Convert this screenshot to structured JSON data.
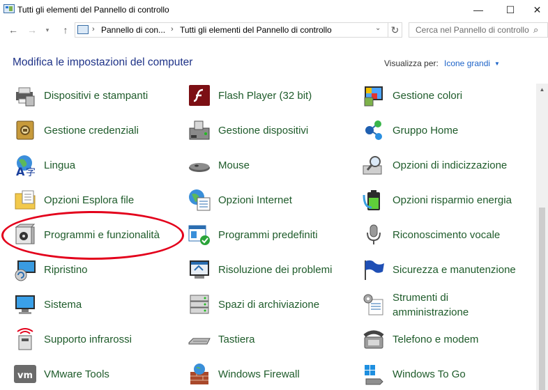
{
  "window": {
    "title": "Tutti gli elementi del Pannello di controllo",
    "minimize_glyph": "—",
    "maximize_glyph": "☐",
    "close_glyph": "✕"
  },
  "nav": {
    "back_glyph": "←",
    "forward_glyph": "→",
    "recent_glyph": "▾",
    "up_glyph": "↑",
    "breadcrumbs": [
      "Pannello di con...",
      "Tutti gli elementi del Pannello di controllo"
    ],
    "separator": "›",
    "dropdown_glyph": "⌄",
    "refresh_glyph": "↻",
    "search_placeholder": "Cerca nel Pannello di controllo",
    "search_glyph": "⌕"
  },
  "header": {
    "title": "Modifica le impostazioni del computer",
    "view_by_label": "Visualizza per:",
    "view_mode": "Icone grandi",
    "view_caret": "▼"
  },
  "colors": {
    "link_green": "#1e5b2a",
    "heading_blue": "#1e3287",
    "accent_blue": "#1e64c8",
    "highlight_red": "#e3001b"
  },
  "items": [
    {
      "label": "Dispositivi e stampanti",
      "icon": "printer-icon"
    },
    {
      "label": "Flash Player (32 bit)",
      "icon": "flash-icon"
    },
    {
      "label": "Gestione colori",
      "icon": "color-management-icon"
    },
    {
      "label": "Gestione credenziali",
      "icon": "credential-safe-icon"
    },
    {
      "label": "Gestione dispositivi",
      "icon": "device-manager-icon"
    },
    {
      "label": "Gruppo Home",
      "icon": "homegroup-icon"
    },
    {
      "label": "Lingua",
      "icon": "language-icon"
    },
    {
      "label": "Mouse",
      "icon": "mouse-icon"
    },
    {
      "label": "Opzioni di indicizzazione",
      "icon": "indexing-icon"
    },
    {
      "label": "Opzioni Esplora file",
      "icon": "folder-options-icon"
    },
    {
      "label": "Opzioni Internet",
      "icon": "internet-globe-icon"
    },
    {
      "label": "Opzioni risparmio energia",
      "icon": "power-battery-icon"
    },
    {
      "label": "Programmi e funzionalità",
      "icon": "programs-features-icon"
    },
    {
      "label": "Programmi predefiniti",
      "icon": "default-programs-icon"
    },
    {
      "label": "Riconoscimento vocale",
      "icon": "microphone-icon"
    },
    {
      "label": "Ripristino",
      "icon": "recovery-icon"
    },
    {
      "label": "Risoluzione dei problemi",
      "icon": "troubleshoot-icon"
    },
    {
      "label": "Sicurezza e manutenzione",
      "icon": "security-flag-icon"
    },
    {
      "label": "Sistema",
      "icon": "system-monitor-icon"
    },
    {
      "label": "Spazi di archiviazione",
      "icon": "storage-spaces-icon"
    },
    {
      "label": "Strumenti di amministrazione",
      "icon": "admin-tools-icon"
    },
    {
      "label": "Supporto infrarossi",
      "icon": "infrared-icon"
    },
    {
      "label": "Tastiera",
      "icon": "keyboard-icon"
    },
    {
      "label": "Telefono e modem",
      "icon": "phone-modem-icon"
    },
    {
      "label": "VMware Tools",
      "icon": "vmware-icon"
    },
    {
      "label": "Windows Firewall",
      "icon": "firewall-icon"
    },
    {
      "label": "Windows To Go",
      "icon": "windows-to-go-icon"
    }
  ],
  "scrollbar": {
    "up_glyph": "▲"
  }
}
